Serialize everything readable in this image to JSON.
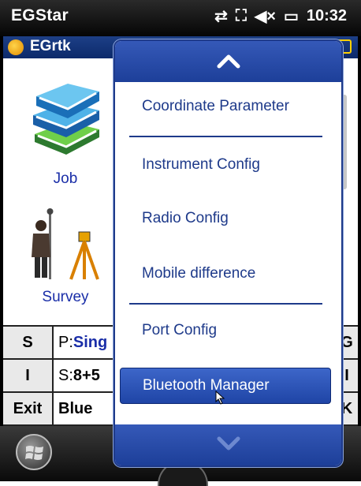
{
  "statusbar": {
    "title": "EGStar",
    "icons": [
      "connectivity-icon",
      "signal-icon",
      "volume-muted-icon",
      "battery-icon"
    ],
    "icon_glyphs": [
      "⇄",
      "⛶",
      "🔇",
      "▭"
    ],
    "time": "10:32"
  },
  "app": {
    "name": "EGrtk",
    "accent_color": "#1d3f86"
  },
  "tiles": [
    {
      "label": "Job",
      "icon": "books-icon"
    },
    {
      "label": "Survey",
      "icon": "surveyor-icon"
    }
  ],
  "info": {
    "rows": [
      {
        "key": "S",
        "prefix": "P:",
        "value": "Sing",
        "right": "G"
      },
      {
        "key": "I",
        "prefix": "S:",
        "value": "8+5",
        "right": "I"
      },
      {
        "key": "Exit",
        "prefix": "",
        "value": "Blue",
        "right": "K"
      }
    ]
  },
  "menu": {
    "items": [
      "Coordinate Parameter",
      "Instrument Config",
      "Radio Config",
      "Mobile difference",
      "Port Config",
      "Bluetooth Manager"
    ],
    "selected": "Bluetooth Manager",
    "scroll_up_icon": "chevron-up-icon",
    "scroll_down_icon": "chevron-down-icon"
  },
  "taskbar": {
    "start_icon": "windows-logo-icon"
  }
}
